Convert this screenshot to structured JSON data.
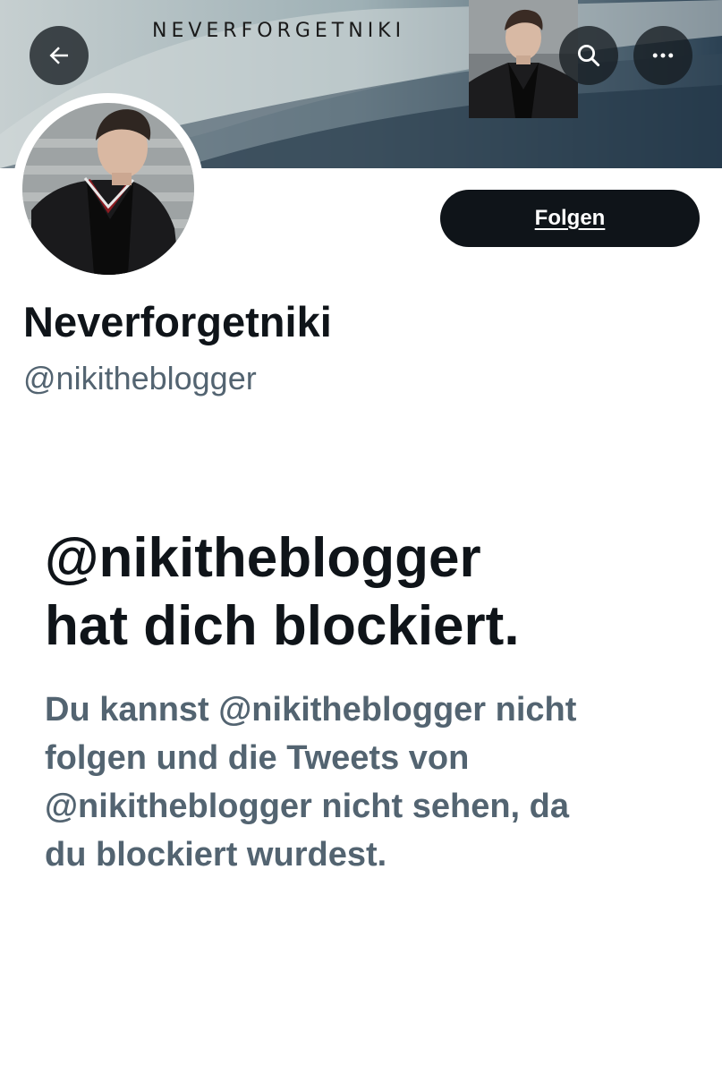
{
  "banner": {
    "title": "NEVERFORGETNIKI"
  },
  "header": {
    "back_icon": "arrow-left-icon",
    "search_icon": "search-icon",
    "more_icon": "more-horizontal-icon"
  },
  "profile": {
    "display_name": "Neverforgetniki",
    "handle": "@nikitheblogger",
    "follow_label": "Folgen"
  },
  "blocked": {
    "title_lines": [
      "@nikitheblogger",
      "hat dich blockiert."
    ],
    "message_lines": [
      "Du kannst @nikitheblogger nicht",
      "folgen und die Tweets von",
      "@nikitheblogger nicht sehen, da",
      "du blockiert wurdest."
    ]
  },
  "colors": {
    "primary_text": "#0f1419",
    "secondary_text": "#536471",
    "button_bg": "#0f1419"
  }
}
